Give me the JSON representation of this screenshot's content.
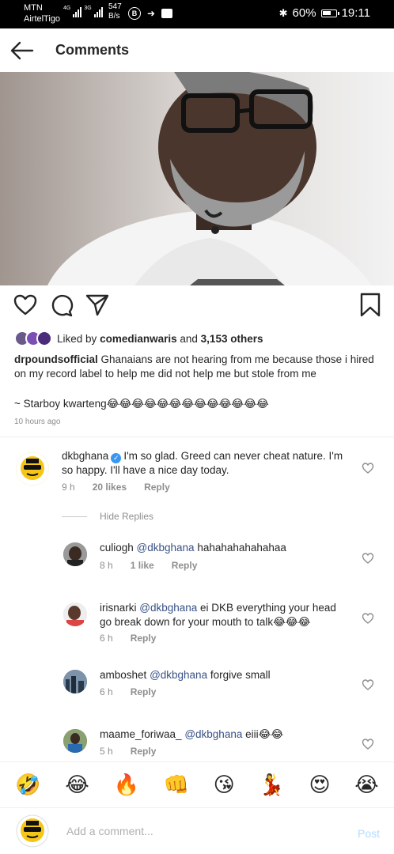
{
  "status_bar": {
    "carrier1": "MTN",
    "carrier2": "AirtelTigo",
    "net1": "4G",
    "net2": "3G",
    "speed_value": "547",
    "speed_unit": "B/s",
    "battery": "60%",
    "time": "19:11"
  },
  "header": {
    "title": "Comments"
  },
  "likes": {
    "prefix": "Liked by",
    "user": "comedianwaris",
    "joiner": "and",
    "others": "3,153 others"
  },
  "post": {
    "username": "drpoundsofficial",
    "caption": " Ghanaians are not hearing from me because those i hired on my record label to help me did not help me but stole from me",
    "caption_line2": "~ Starboy kwarteng😂😂😂😂😂😂😂😂😂😂😂😂😂",
    "time": "10 hours ago"
  },
  "comments": [
    {
      "username": "dkbghana",
      "text": "I'm so glad. Greed can never cheat nature. I'm so happy. I'll have a nice day today.",
      "time": "9 h",
      "likes": "20 likes",
      "reply": "Reply"
    }
  ],
  "hide_replies": "Hide Replies",
  "replies": [
    {
      "username": "culiogh",
      "mention": "@dkbghana",
      "text": " hahahahahahahaa",
      "time": "8 h",
      "likes": "1 like",
      "reply": "Reply"
    },
    {
      "username": "irisnarki",
      "mention": "@dkbghana",
      "text": " ei DKB everything your head go break down for your mouth to talk😂😂😂",
      "time": "6 h",
      "reply": "Reply"
    },
    {
      "username": "amboshet",
      "mention": "@dkbghana",
      "text": " forgive small",
      "time": "6 h",
      "reply": "Reply"
    },
    {
      "username": "maame_foriwaa_",
      "mention": "@dkbghana",
      "text": " eiii😂😂",
      "time": "5 h",
      "reply": "Reply"
    }
  ],
  "emoji_bar": [
    "🤣",
    "😂",
    "🔥",
    "👊",
    "😘",
    "💃",
    "😍",
    "😭"
  ],
  "composer": {
    "placeholder": "Add a comment...",
    "post_label": "Post"
  },
  "colors": {
    "link": "#385185",
    "verified": "#3897f0",
    "muted": "#8e8e8e",
    "post_disabled": "#b3dbff"
  }
}
